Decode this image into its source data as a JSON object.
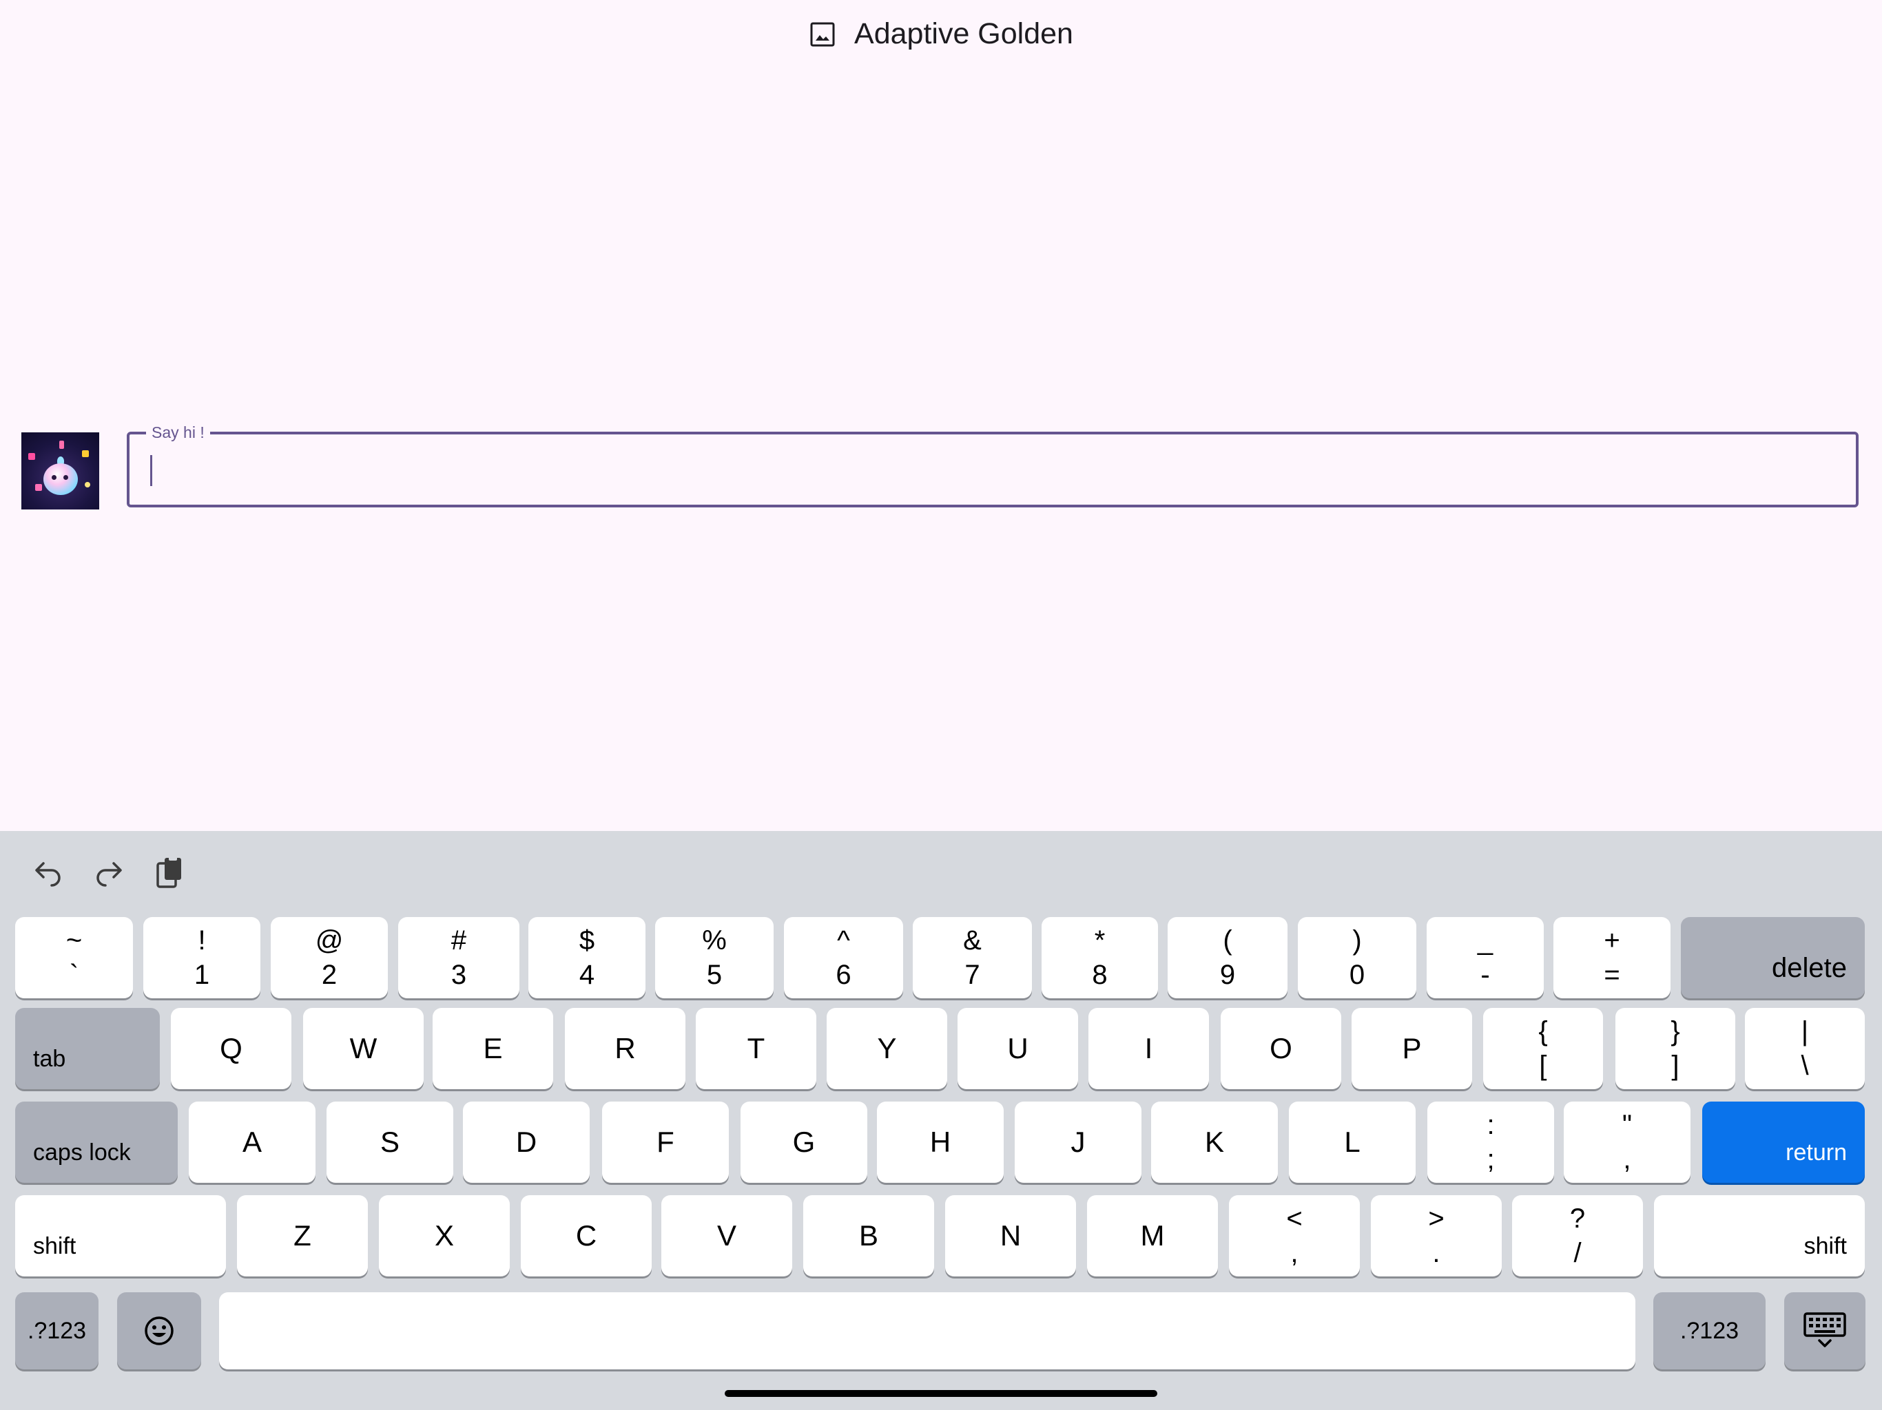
{
  "header": {
    "title": "Adaptive Golden",
    "icon": "image-icon"
  },
  "input": {
    "label": "Say hi !",
    "value": ""
  },
  "toolbar": {
    "icons": [
      "undo-icon",
      "redo-icon",
      "clipboard-icon"
    ]
  },
  "keyboard": {
    "row1": [
      {
        "top": "~",
        "bottom": "`"
      },
      {
        "top": "!",
        "bottom": "1"
      },
      {
        "top": "@",
        "bottom": "2"
      },
      {
        "top": "#",
        "bottom": "3"
      },
      {
        "top": "$",
        "bottom": "4"
      },
      {
        "top": "%",
        "bottom": "5"
      },
      {
        "top": "^",
        "bottom": "6"
      },
      {
        "top": "&",
        "bottom": "7"
      },
      {
        "top": "*",
        "bottom": "8"
      },
      {
        "top": "(",
        "bottom": "9"
      },
      {
        "top": ")",
        "bottom": "0"
      },
      {
        "top": "_",
        "bottom": "-"
      },
      {
        "top": "+",
        "bottom": "="
      }
    ],
    "delete": "delete",
    "tab": "tab",
    "row2": [
      "Q",
      "W",
      "E",
      "R",
      "T",
      "Y",
      "U",
      "I",
      "O",
      "P"
    ],
    "row2_sym": [
      {
        "top": "{",
        "bottom": "["
      },
      {
        "top": "}",
        "bottom": "]"
      },
      {
        "top": "|",
        "bottom": "\\"
      }
    ],
    "caps": "caps lock",
    "row3": [
      "A",
      "S",
      "D",
      "F",
      "G",
      "H",
      "J",
      "K",
      "L"
    ],
    "row3_sym": [
      {
        "top": ":",
        "bottom": ";"
      },
      {
        "top": "\"",
        "bottom": ","
      }
    ],
    "return": "return",
    "shift": "shift",
    "row4": [
      "Z",
      "X",
      "C",
      "V",
      "B",
      "N",
      "M"
    ],
    "row4_sym": [
      {
        "top": "<",
        "bottom": ","
      },
      {
        "top": ">",
        "bottom": "."
      },
      {
        "top": "?",
        "bottom": "/"
      }
    ],
    "num_label": ".?123",
    "emoji_icon": "emoji-icon",
    "hide_icon": "keyboard-dismiss-icon"
  }
}
